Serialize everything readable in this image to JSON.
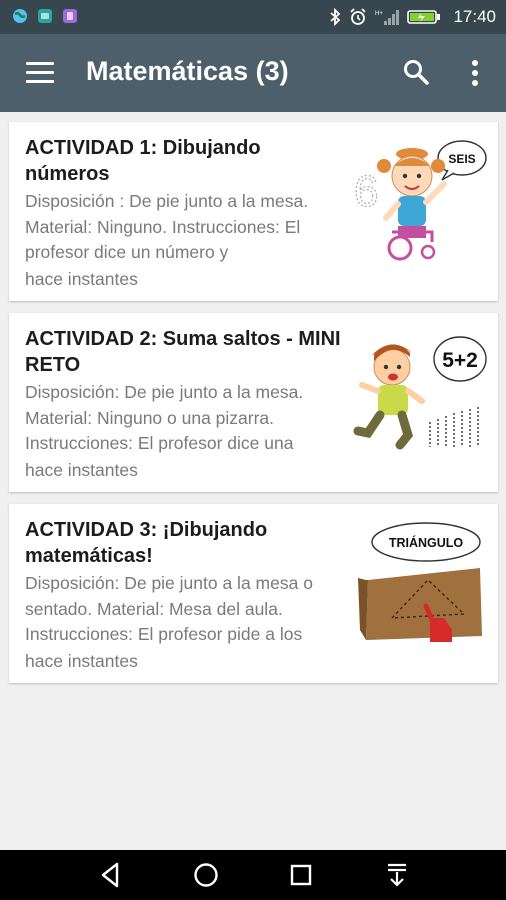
{
  "status_bar": {
    "time": "17:40",
    "colors": {
      "background": "#37464f",
      "battery": "#7fd32a"
    }
  },
  "app_bar": {
    "title": "Matemáticas (3)",
    "colors": {
      "background": "#4c5f6a"
    }
  },
  "activities": [
    {
      "title": "ACTIVIDAD 1: Dibujando números",
      "description": "Disposición : De pie junto a la mesa. Material: Ninguno. Instrucciones: El profesor dice un número y",
      "more": "hace instantes",
      "image_label": "SEIS"
    },
    {
      "title": "ACTIVIDAD 2: Suma saltos - MINI RETO",
      "description": "Disposición: De pie junto a la mesa. Material: Ninguno o una pizarra. Instrucciones: El profesor dice una",
      "more": "hace instantes",
      "image_label": "5+2"
    },
    {
      "title": "ACTIVIDAD 3: ¡Dibujando matemáticas!",
      "description": "Disposición: De pie junto a la mesa o sentado. Material: Mesa del aula. Instrucciones: El profesor pide a los",
      "more": "hace instantes",
      "image_label": "TRIÁNGULO"
    }
  ],
  "icons": {
    "menu": "hamburger-icon",
    "search": "search-icon",
    "more": "more-vert-icon",
    "nav_back": "back-triangle-icon",
    "nav_home": "home-circle-icon",
    "nav_recents": "recents-square-icon",
    "nav_notifications": "notification-pulldown-icon"
  }
}
